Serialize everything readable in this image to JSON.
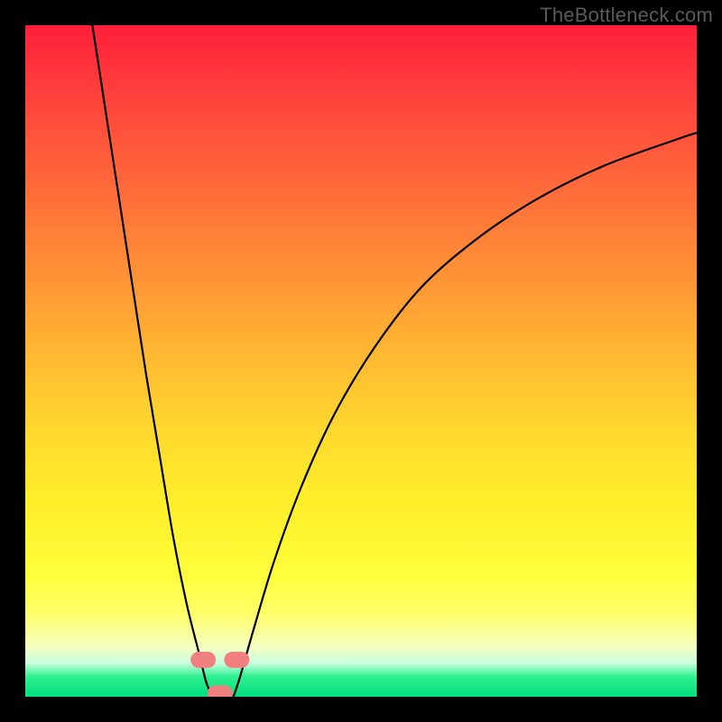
{
  "watermark": "TheBottleneck.com",
  "chart_data": {
    "type": "line",
    "title": "",
    "xlabel": "",
    "ylabel": "",
    "xlim": [
      0,
      100
    ],
    "ylim": [
      0,
      100
    ],
    "series": [
      {
        "name": "left-branch",
        "x": [
          10,
          12,
          14,
          16,
          18,
          20,
          22,
          24,
          26,
          27,
          28
        ],
        "y": [
          100,
          87,
          74,
          61,
          48,
          36,
          24,
          14,
          6,
          2,
          0
        ]
      },
      {
        "name": "right-branch",
        "x": [
          31,
          32,
          34,
          37,
          41,
          46,
          52,
          59,
          67,
          76,
          86,
          97,
          100
        ],
        "y": [
          0,
          3,
          10,
          20,
          31,
          42,
          52,
          61,
          68,
          74,
          79,
          83,
          84
        ]
      }
    ],
    "markers": [
      {
        "name": "left-blob",
        "x": 26.5,
        "y": 5.5
      },
      {
        "name": "right-blob",
        "x": 31.5,
        "y": 5.5
      },
      {
        "name": "bottom-blob",
        "x": 29,
        "y": 0.5
      }
    ]
  }
}
